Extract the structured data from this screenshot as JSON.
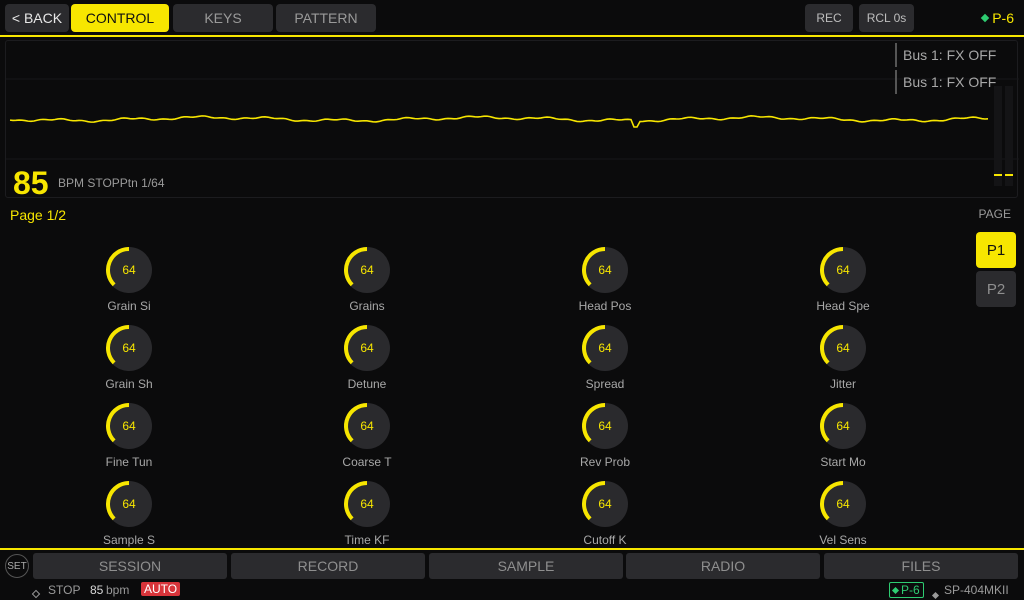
{
  "topbar": {
    "back_label": "< BACK",
    "tabs": [
      {
        "label": "CONTROL",
        "active": true
      },
      {
        "label": "KEYS",
        "active": false
      },
      {
        "label": "PATTERN",
        "active": false
      }
    ],
    "rec_label": "REC",
    "rcl_label": "RCL 0s",
    "device_label": "P-6"
  },
  "wave": {
    "bpm": "85",
    "info": "BPM STOPPtn 1/64",
    "bus_labels": [
      "Bus 1: FX OFF",
      "Bus 1: FX OFF"
    ]
  },
  "page": {
    "label": "Page 1/2",
    "title": "PAGE",
    "buttons": [
      {
        "label": "P1",
        "active": true
      },
      {
        "label": "P2",
        "active": false
      }
    ]
  },
  "knobs": [
    {
      "label": "Grain Si",
      "value": "64"
    },
    {
      "label": "Grains",
      "value": "64"
    },
    {
      "label": "Head Pos",
      "value": "64"
    },
    {
      "label": "Head Spe",
      "value": "64"
    },
    {
      "label": "Grain Sh",
      "value": "64"
    },
    {
      "label": "Detune",
      "value": "64"
    },
    {
      "label": "Spread",
      "value": "64"
    },
    {
      "label": "Jitter",
      "value": "64"
    },
    {
      "label": "Fine Tun",
      "value": "64"
    },
    {
      "label": "Coarse T",
      "value": "64"
    },
    {
      "label": "Rev Prob",
      "value": "64"
    },
    {
      "label": "Start Mo",
      "value": "64"
    },
    {
      "label": "Sample S",
      "value": "64"
    },
    {
      "label": "Time KF",
      "value": "64"
    },
    {
      "label": "Cutoff K",
      "value": "64"
    },
    {
      "label": "Vel Sens",
      "value": "64"
    }
  ],
  "knob_level": 0.5,
  "nav": {
    "set_label": "SET",
    "items": [
      "SESSION",
      "RECORD",
      "SAMPLE",
      "RADIO",
      "FILES"
    ]
  },
  "status": {
    "state": "STOP",
    "bpm_value": "85",
    "bpm_unit": "bpm",
    "auto_label": "AUTO",
    "device_badge": "P-6",
    "model": "SP-404MKII"
  },
  "colors": {
    "accent": "#f7e600",
    "background": "#0b0b0c",
    "button": "#2b2b2e",
    "status_green": "#2ecc71",
    "auto_red": "#d8343a"
  }
}
